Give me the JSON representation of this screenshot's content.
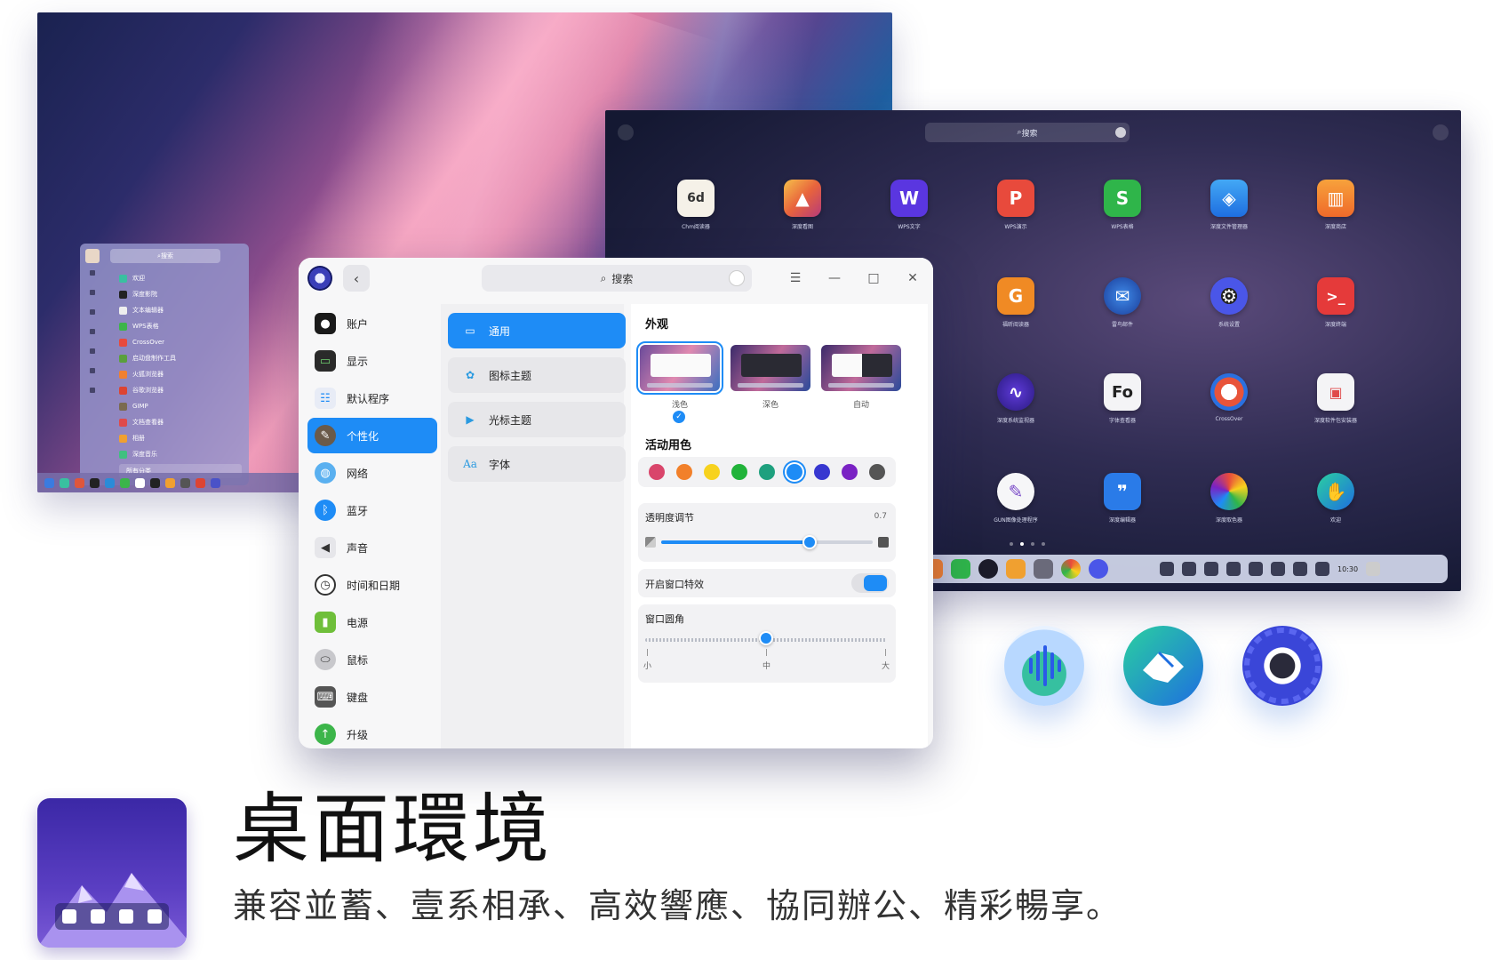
{
  "launcher_small": {
    "search": "搜索",
    "items": [
      "欢迎",
      "深度影院",
      "文本编辑器",
      "WPS表格",
      "CrossOver",
      "启动盘制作工具",
      "火狐浏览器",
      "谷歌浏览器",
      "GIMP",
      "文档查看器",
      "相册",
      "深度音乐"
    ],
    "all_categories": "所有分类"
  },
  "launcher_full": {
    "search": "搜索",
    "apps_row1": [
      "Chm阅读器",
      "深度看图",
      "WPS文字",
      "WPS演示",
      "WPS表格",
      "深度文件管理器",
      "深度商店"
    ],
    "apps_row2": [
      "福昕阅读器",
      "雷鸟邮件",
      "系统设置",
      "深度终端"
    ],
    "apps_row3": [
      "深度系统监视器",
      "字体查看器",
      "CrossOver",
      "深度软件包安装器"
    ],
    "apps_row4": [
      "GUN图像处理程序",
      "深度编辑器",
      "深度取色器",
      "欢迎"
    ],
    "clock_time": "10:30"
  },
  "control_center": {
    "search": "搜索",
    "nav": [
      "账户",
      "显示",
      "默认程序",
      "个性化",
      "网络",
      "蓝牙",
      "声音",
      "时间和日期",
      "电源",
      "鼠标",
      "键盘",
      "升级"
    ],
    "nav_active": "个性化",
    "sub": [
      "通用",
      "图标主题",
      "光标主题",
      "字体"
    ],
    "sub_active": "通用",
    "appearance_title": "外观",
    "themes": [
      "浅色",
      "深色",
      "自动"
    ],
    "accent_title": "活动用色",
    "accent_colors": [
      "#d9456b",
      "#f2802a",
      "#f7d21e",
      "#21b33a",
      "#1ea07e",
      "#1e8cf6",
      "#3737d0",
      "#7a22c4",
      "#555555"
    ],
    "accent_selected": "#1e8cf6",
    "transparency_label": "透明度调节",
    "transparency_value": "0.7",
    "transparency_fraction": 0.7,
    "effects_label": "开启窗口特效",
    "effects_on": true,
    "corner_label": "窗口圆角",
    "corner_marks": [
      "小",
      "中",
      "大"
    ],
    "corner_selected": "中"
  },
  "banner": {
    "title": "桌面環境",
    "subtitle": "兼容並蓄、壹系相承、高效響應、協同辦公、精彩暢享。"
  },
  "colors": {
    "accent": "#1e8cf6"
  }
}
